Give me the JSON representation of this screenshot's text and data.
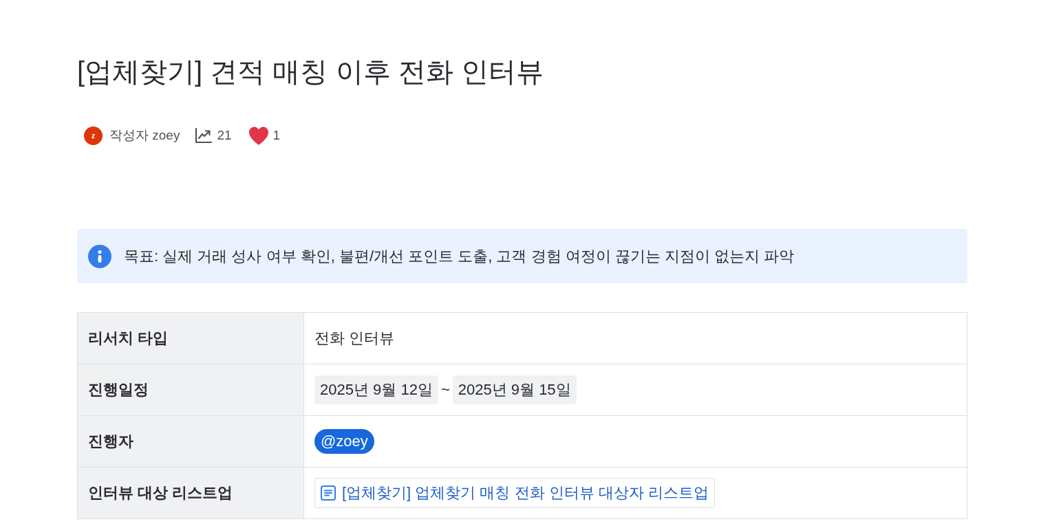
{
  "page": {
    "title": "[업체찾기] 견적 매칭 이후 전화 인터뷰"
  },
  "byline": {
    "author_initial": "z",
    "author_label": "작성자 zoey",
    "views": "21",
    "likes": "1"
  },
  "info_panel": {
    "text": "목표: 실제 거래 성사 여부 확인, 불편/개선 포인트 도출, 고객 경험 여정이 끊기는 지점이 없는지 파악"
  },
  "table": {
    "rows": [
      {
        "label": "리서치 타입",
        "kind": "text",
        "value": "전화 인터뷰"
      },
      {
        "label": "진행일정",
        "kind": "date_range",
        "start": "2025년 9월 12일",
        "separator": "~",
        "end": "2025년 9월 15일"
      },
      {
        "label": "진행자",
        "kind": "mention",
        "value": "@zoey"
      },
      {
        "label": "인터뷰 대상 리스트업",
        "kind": "page_link",
        "value": "[업체찾기] 업체찾기 매칭 전화 인터뷰 대상자 리스트업"
      }
    ]
  }
}
